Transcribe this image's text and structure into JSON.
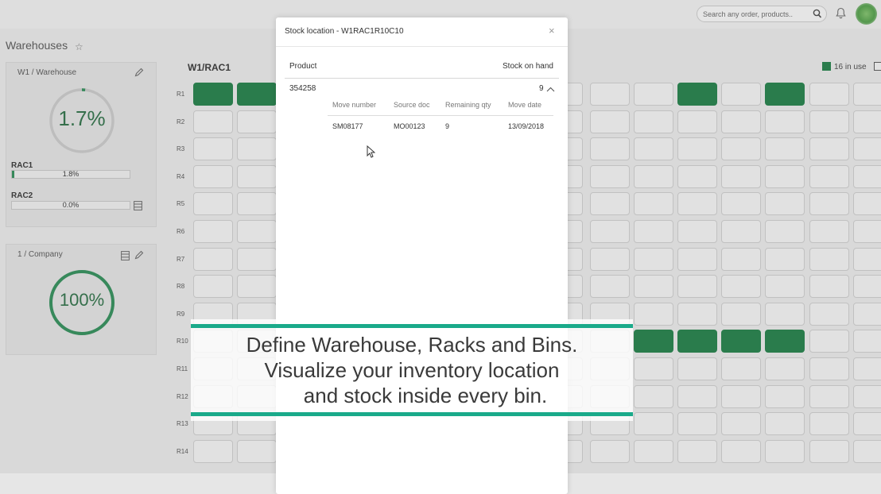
{
  "topbar": {
    "search_placeholder": "Search any order, products..",
    "search_icon": "search-icon",
    "notification_icon": "bell-icon",
    "avatar_icon": "user-avatar"
  },
  "page": {
    "title": "Warehouses"
  },
  "warehouse_card": {
    "title": "W1 / Warehouse",
    "usage": "1.7%",
    "usage_fraction": 0.017,
    "racks": [
      {
        "name": "RAC1",
        "value": "1.8%",
        "fraction": 0.018
      },
      {
        "name": "RAC2",
        "value": "0.0%",
        "fraction": 0.0
      }
    ]
  },
  "company_card": {
    "title": "1 / Company",
    "usage": "100%",
    "usage_fraction": 1.0
  },
  "grid": {
    "title": "W1/RAC1",
    "legend_label": "16 in use",
    "rows": [
      "R1",
      "R2",
      "R3",
      "R4",
      "R5",
      "R6",
      "R7",
      "R8",
      "R9",
      "R10",
      "R11",
      "R12",
      "R13",
      "R14"
    ],
    "used_color": "#1f7d46"
  },
  "modal": {
    "title": "Stock location - W1RAC1R10C10",
    "close": "×",
    "col_product": "Product",
    "col_stock": "Stock on hand",
    "product": "354258",
    "stock": "9",
    "sub_headers": [
      "Move number",
      "Source doc",
      "Remaining qty",
      "Move date"
    ],
    "moves": [
      {
        "number": "SM08177",
        "source": "MO00123",
        "remaining": "9",
        "date": "13/09/2018"
      }
    ]
  },
  "banner": {
    "lines": [
      "Define Warehouse, Racks and Bins.",
      "Visualize your inventory location",
      "and stock inside every bin."
    ],
    "accent": "#1aaa8a"
  }
}
